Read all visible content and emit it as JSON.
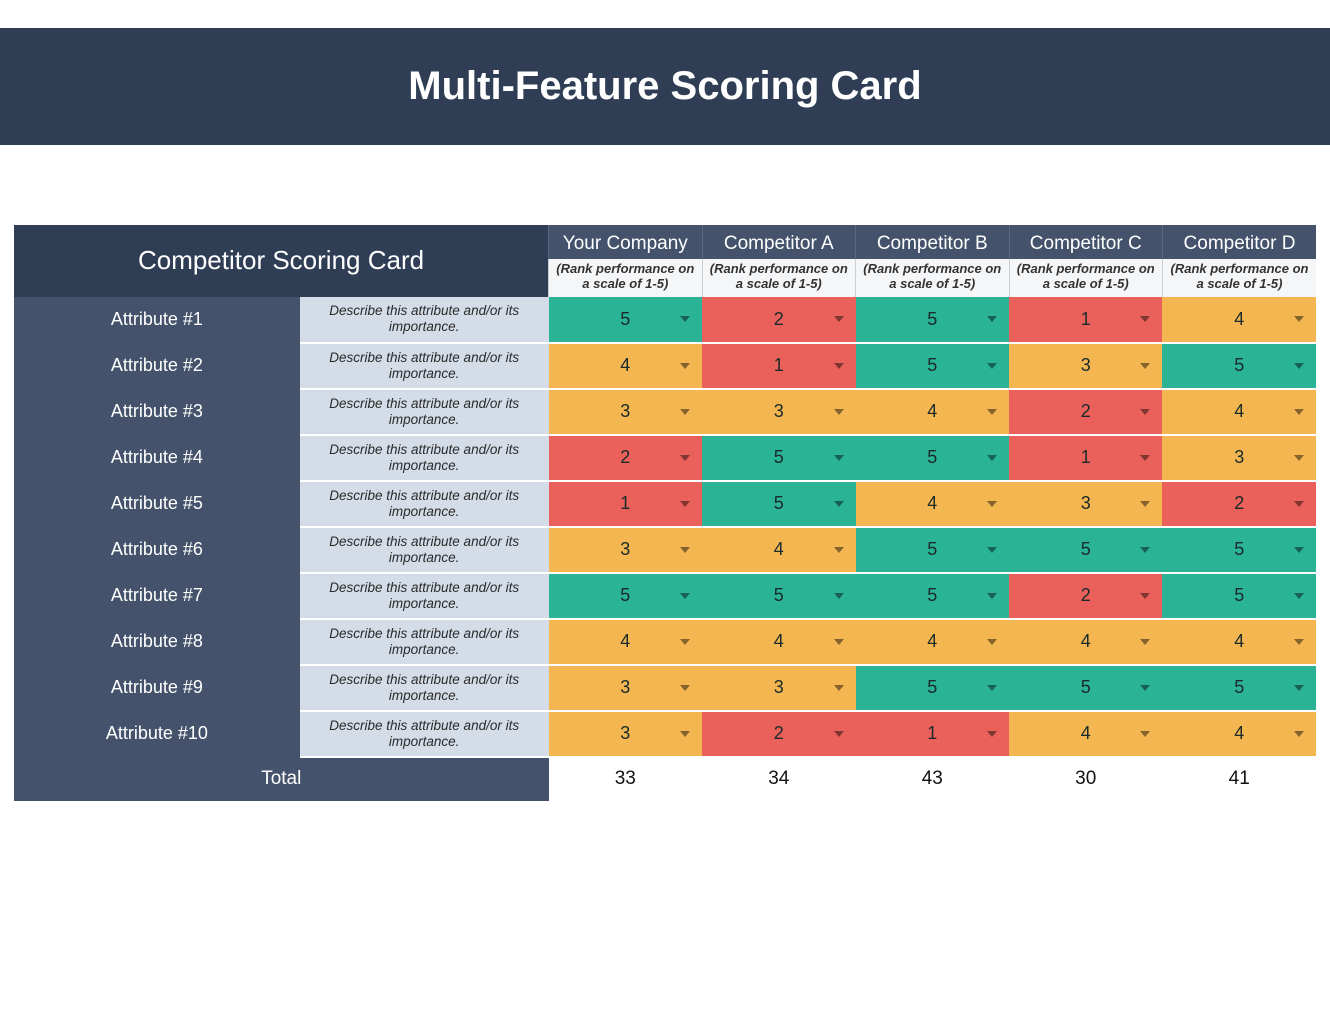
{
  "title": "Multi-Feature Scoring Card",
  "table_title": "Competitor Scoring Card",
  "rank_hint": "(Rank performance on a scale of 1-5)",
  "desc_placeholder": "Describe this attribute and/or its importance.",
  "total_label": "Total",
  "competitors": [
    {
      "name": "Your Company"
    },
    {
      "name": "Competitor A"
    },
    {
      "name": "Competitor B"
    },
    {
      "name": "Competitor C"
    },
    {
      "name": "Competitor D"
    }
  ],
  "attributes": [
    {
      "label": "Attribute #1",
      "scores": [
        5,
        2,
        5,
        1,
        4
      ]
    },
    {
      "label": "Attribute #2",
      "scores": [
        4,
        1,
        5,
        3,
        5
      ]
    },
    {
      "label": "Attribute #3",
      "scores": [
        3,
        3,
        4,
        2,
        4
      ]
    },
    {
      "label": "Attribute #4",
      "scores": [
        2,
        5,
        5,
        1,
        3
      ]
    },
    {
      "label": "Attribute #5",
      "scores": [
        1,
        5,
        4,
        3,
        2
      ]
    },
    {
      "label": "Attribute #6",
      "scores": [
        3,
        4,
        5,
        5,
        5
      ]
    },
    {
      "label": "Attribute #7",
      "scores": [
        5,
        5,
        5,
        2,
        5
      ]
    },
    {
      "label": "Attribute #8",
      "scores": [
        4,
        4,
        4,
        4,
        4
      ]
    },
    {
      "label": "Attribute #9",
      "scores": [
        3,
        3,
        5,
        5,
        5
      ]
    },
    {
      "label": "Attribute #10",
      "scores": [
        3,
        2,
        1,
        4,
        4
      ]
    }
  ],
  "totals": [
    33,
    34,
    43,
    30,
    41
  ],
  "colors": {
    "red": "#e9615a",
    "yellow": "#f3b650",
    "green": "#2bb396",
    "header_dark": "#2f3e55",
    "header_mid": "#44536b"
  },
  "chart_data": {
    "type": "table",
    "title": "Competitor Scoring Card",
    "columns": [
      "Your Company",
      "Competitor A",
      "Competitor B",
      "Competitor C",
      "Competitor D"
    ],
    "rows": [
      "Attribute #1",
      "Attribute #2",
      "Attribute #3",
      "Attribute #4",
      "Attribute #5",
      "Attribute #6",
      "Attribute #7",
      "Attribute #8",
      "Attribute #9",
      "Attribute #10"
    ],
    "values": [
      [
        5,
        2,
        5,
        1,
        4
      ],
      [
        4,
        1,
        5,
        3,
        5
      ],
      [
        3,
        3,
        4,
        2,
        4
      ],
      [
        2,
        5,
        5,
        1,
        3
      ],
      [
        1,
        5,
        4,
        3,
        2
      ],
      [
        3,
        4,
        5,
        5,
        5
      ],
      [
        5,
        5,
        5,
        2,
        5
      ],
      [
        4,
        4,
        4,
        4,
        4
      ],
      [
        3,
        3,
        5,
        5,
        5
      ],
      [
        3,
        2,
        1,
        4,
        4
      ]
    ],
    "totals": [
      33,
      34,
      43,
      30,
      41
    ],
    "scale": [
      1,
      5
    ],
    "color_rule": "1-2 red, 3-4 yellow, 5 green"
  }
}
